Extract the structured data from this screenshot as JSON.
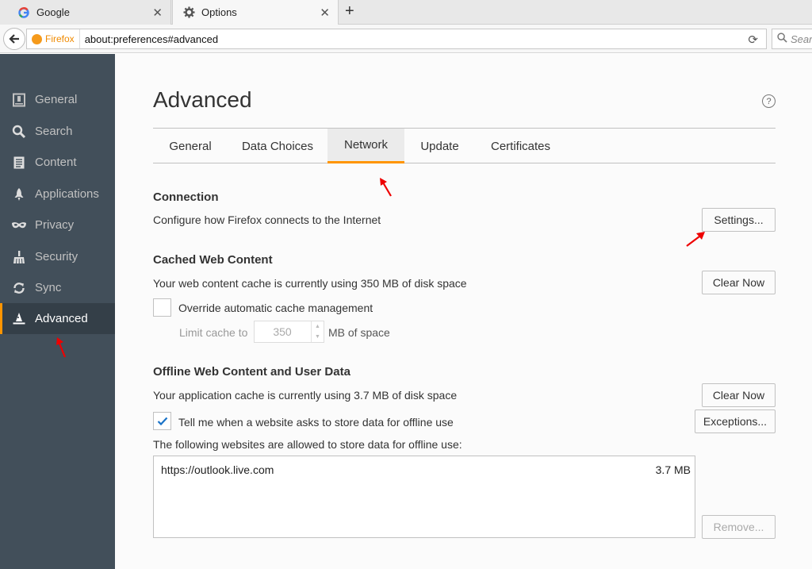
{
  "browser": {
    "tabs": [
      {
        "title": "Google",
        "favicon": "google-icon"
      },
      {
        "title": "Options",
        "favicon": "gear-icon"
      }
    ],
    "identity_label": "Firefox",
    "url": "about:preferences#advanced",
    "search_placeholder": "Sear"
  },
  "sidebar": {
    "items": [
      {
        "label": "General",
        "icon": "general-icon"
      },
      {
        "label": "Search",
        "icon": "search-icon"
      },
      {
        "label": "Content",
        "icon": "document-icon"
      },
      {
        "label": "Applications",
        "icon": "rocket-icon"
      },
      {
        "label": "Privacy",
        "icon": "mask-icon"
      },
      {
        "label": "Security",
        "icon": "broom-icon"
      },
      {
        "label": "Sync",
        "icon": "sync-icon"
      },
      {
        "label": "Advanced",
        "icon": "wizard-hat-icon",
        "selected": true
      }
    ]
  },
  "main": {
    "heading": "Advanced",
    "tabs": [
      {
        "label": "General"
      },
      {
        "label": "Data Choices"
      },
      {
        "label": "Network",
        "active": true
      },
      {
        "label": "Update"
      },
      {
        "label": "Certificates"
      }
    ],
    "connection": {
      "title": "Connection",
      "desc": "Configure how Firefox connects to the Internet",
      "settings_button": "Settings..."
    },
    "cache": {
      "title": "Cached Web Content",
      "desc": "Your web content cache is currently using 350 MB of disk space",
      "clear_button": "Clear Now",
      "override_label": "Override automatic cache management",
      "override_checked": false,
      "limit_label": "Limit cache to",
      "limit_value": "350",
      "limit_unit": "MB of space"
    },
    "offline": {
      "title": "Offline Web Content and User Data",
      "desc": "Your application cache is currently using 3.7 MB of disk space",
      "clear_button": "Clear Now",
      "tell_label": "Tell me when a website asks to store data for offline use",
      "tell_checked": true,
      "exceptions_button": "Exceptions...",
      "allowed_label": "The following websites are allowed to store data for offline use:",
      "sites": [
        {
          "url": "https://outlook.live.com",
          "size": "3.7 MB"
        }
      ],
      "remove_button": "Remove..."
    }
  },
  "colors": {
    "accent": "#ff9500",
    "sidebar_bg": "#424f5a",
    "annotation_arrow": "#ee0000"
  }
}
